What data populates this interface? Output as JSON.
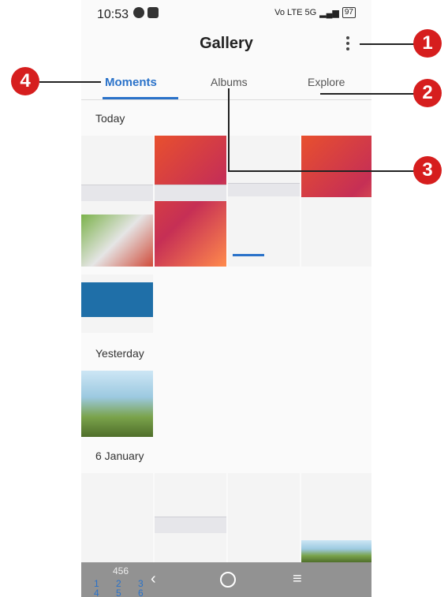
{
  "status": {
    "time": "10:53",
    "network": "Vo LTE 5G",
    "battery": "97"
  },
  "appbar": {
    "title": "Gallery"
  },
  "tabs": [
    {
      "label": "Moments"
    },
    {
      "label": "Albums"
    },
    {
      "label": "Explore"
    }
  ],
  "sections": {
    "today": "Today",
    "yesterday": "Yesterday",
    "january": "6 January"
  },
  "nav": {
    "digits": "456",
    "keys": [
      "1",
      "2",
      "3",
      "4",
      "5",
      "6"
    ]
  },
  "callouts": [
    "1",
    "2",
    "3",
    "4"
  ],
  "colors": {
    "accent": "#2a72c9",
    "callout": "#d61e1e"
  }
}
